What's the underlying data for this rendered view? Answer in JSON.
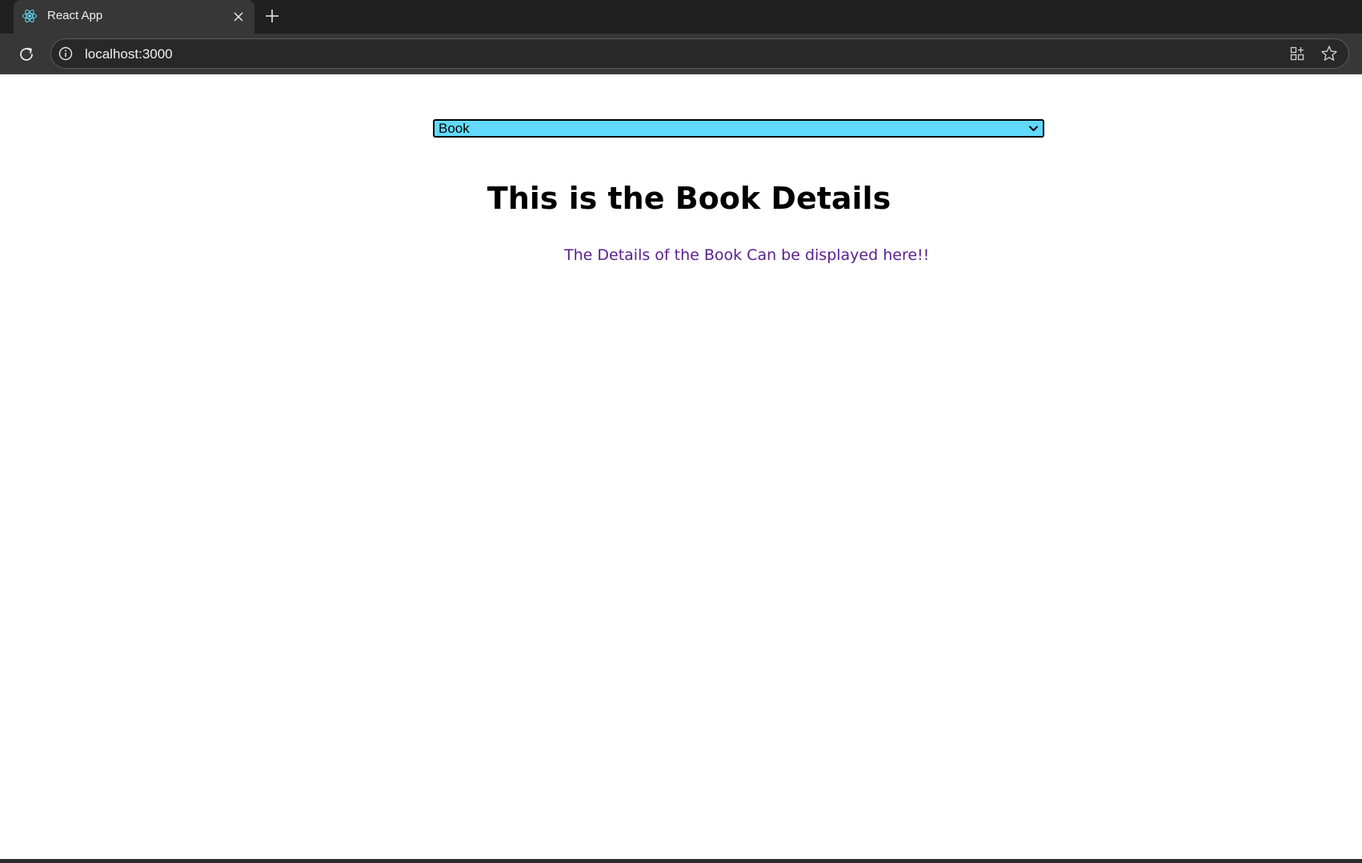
{
  "browser": {
    "tab": {
      "title": "React App",
      "favicon": "react-icon"
    },
    "address_bar": {
      "url": "localhost:3000"
    },
    "icons": {
      "reload": "reload-icon",
      "site_info": "info-icon",
      "close_tab": "close-icon",
      "new_tab": "plus-icon",
      "apps": "apps-icon",
      "bookmark": "star-icon"
    }
  },
  "page": {
    "select": {
      "selected": "Book",
      "background_color": "#61dafb"
    },
    "heading": "This is the Book Details",
    "description": "The Details of the Book Can be displayed here!!",
    "description_color": "#5b1e8c"
  }
}
